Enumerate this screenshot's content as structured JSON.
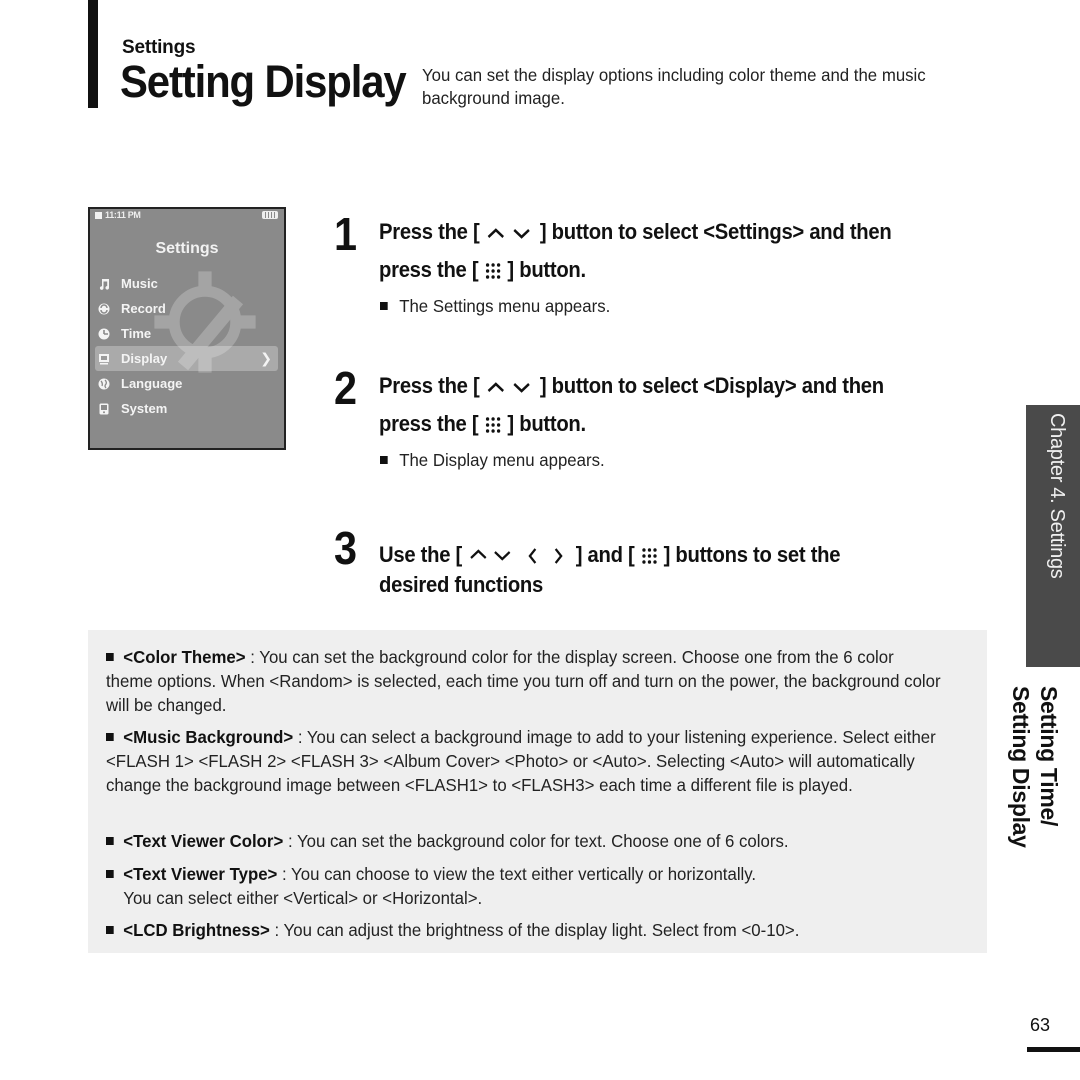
{
  "header": {
    "section": "Settings",
    "title": "Setting Display",
    "description": "You can set the display options including color theme and the music background image."
  },
  "device_screen": {
    "status_time": "11:11 PM",
    "title": "Settings",
    "menu": [
      {
        "label": "Music",
        "icon": "music-note-icon",
        "active": false
      },
      {
        "label": "Record",
        "icon": "record-icon",
        "active": false
      },
      {
        "label": "Time",
        "icon": "clock-icon",
        "active": false
      },
      {
        "label": "Display",
        "icon": "display-icon",
        "active": true
      },
      {
        "label": "Language",
        "icon": "globe-icon",
        "active": false
      },
      {
        "label": "System",
        "icon": "system-icon",
        "active": false
      }
    ]
  },
  "steps": [
    {
      "number": "1",
      "line1_pre": "Press the [",
      "line1_post": "] button to select <Settings> and then",
      "line2_pre": "press the [",
      "line2_post": "] button.",
      "note": "The Settings menu appears."
    },
    {
      "number": "2",
      "line1_pre": "Press the [",
      "line1_post": "] button to select <Display> and then",
      "line2_pre": "press the [",
      "line2_post": "] button.",
      "note": "The Display menu appears."
    },
    {
      "number": "3",
      "line1_pre": "Use the [",
      "line1_mid": "] and [",
      "line1_post": "] buttons to set the",
      "line2": "desired functions"
    }
  ],
  "options": [
    {
      "term": "<Color Theme>",
      "text": " : You can set the background color for the display screen. Choose one from the 6 color theme options. When <Random> is selected, each time you turn off and turn on the power, the background color will be changed."
    },
    {
      "term": "<Music Background>",
      "text": " : You can select a background image to add to your listening experience. Select either <FLASH 1> <FLASH 2> <FLASH 3> <Album Cover> <Photo> or <Auto>. Selecting <Auto> will automatically change the background image between <FLASH1> to <FLASH3> each time a different file is played."
    },
    {
      "term": "<Text Viewer Color>",
      "text": " : You can set the background color for text. Choose one of 6 colors."
    },
    {
      "term": "<Text Viewer Type>",
      "text": " : You can choose to view the text either vertically or horizontally.",
      "text2": "You can select either <Vertical> or <Horizontal>."
    },
    {
      "term": "<LCD Brightness>",
      "text": " : You can adjust the brightness of the display light. Select from <0-10>."
    }
  ],
  "side": {
    "chapter": "Chapter 4. Settings",
    "line1": "Setting Time/",
    "line2": "Setting Display"
  },
  "page_number": "63",
  "colors": {
    "panel_bg": "#efefef",
    "chapter_tab_bg": "#4a4a4a",
    "screen_bg": "#8a8a8a"
  }
}
